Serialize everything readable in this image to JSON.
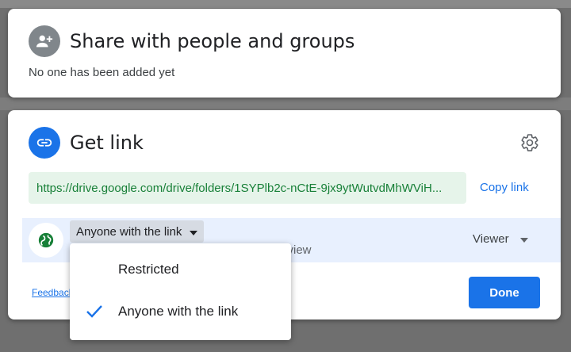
{
  "share": {
    "title": "Share with people and groups",
    "subtitle": "No one has been added yet",
    "icon": "person-add-icon"
  },
  "get_link": {
    "title": "Get link",
    "icon": "link-icon",
    "settings_icon": "gear-icon",
    "url": "https://drive.google.com/drive/folders/1SYPlb2c-nCtE-9jx9ytWutvdMhWViH...",
    "copy_label": "Copy link",
    "access_value": "Anyone with the link",
    "access_desc_partial": "n view",
    "role_value": "Viewer",
    "feedback_label": "Feedback",
    "done_label": "Done"
  },
  "dropdown": {
    "options": [
      "Restricted",
      "Anyone with the link"
    ],
    "selected_index": 1
  },
  "colors": {
    "primary": "#1a73e8",
    "link_green": "#188038",
    "url_bg": "#e6f4ea",
    "access_bg": "#e8f0fe"
  }
}
